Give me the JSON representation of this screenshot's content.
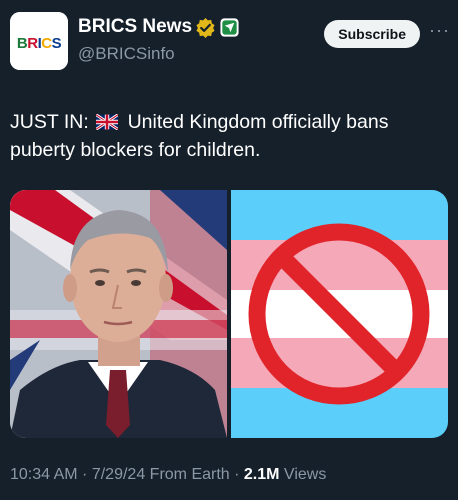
{
  "account": {
    "display_name": "BRICS News",
    "handle": "@BRICSinfo",
    "avatar_text": "BRICS",
    "verified_badge": "gold-check-icon",
    "affiliate_badge": "affiliate-badge-icon"
  },
  "actions": {
    "subscribe_label": "Subscribe",
    "more_label": "···"
  },
  "tweet": {
    "prefix": "JUST IN:",
    "flag": "uk-flag-icon",
    "text": "United Kingdom officially bans puberty blockers for children."
  },
  "footer": {
    "time": "10:34 AM",
    "sep1": " · ",
    "date": "7/29/24",
    "source": " From Earth",
    "sep2": " · ",
    "views_count": "2.1M",
    "views_label": " Views"
  },
  "colors": {
    "background": "#15202b",
    "muted_text": "#8b98a5",
    "trans_blue": "#5bcefa",
    "trans_pink": "#f5a9b8",
    "prohibition_red": "#e0242a"
  }
}
